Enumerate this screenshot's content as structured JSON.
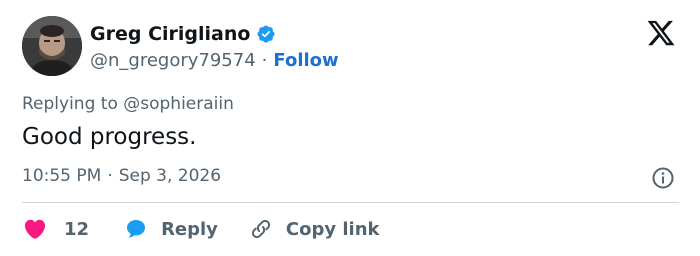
{
  "author": {
    "name": "Greg Cirigliano",
    "handle": "@n_gregory79574",
    "separator": "·",
    "follow_label": "Follow"
  },
  "reply_context": {
    "prefix": "Replying to",
    "mention": "@sophieraiin"
  },
  "tweet": {
    "text": "Good progress.",
    "time": "10:55 PM",
    "separator": "·",
    "date": "Sep 3, 2026"
  },
  "actions": {
    "like_count": "12",
    "reply_label": "Reply",
    "copy_label": "Copy link"
  },
  "icons": {
    "brand": "x-logo-icon",
    "verified": "verified-badge-icon",
    "info": "info-icon",
    "like": "heart-icon",
    "reply": "chat-bubble-icon",
    "copy": "link-icon"
  },
  "colors": {
    "accent": "#1d6fd0",
    "verified": "#1d9bf0",
    "like": "#f91880",
    "muted": "#536471",
    "text": "#0f1419",
    "divider": "#cfd9de"
  }
}
